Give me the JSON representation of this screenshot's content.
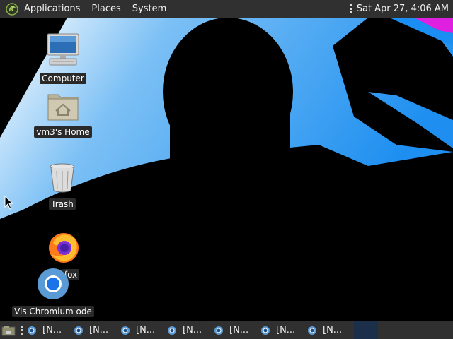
{
  "top_panel": {
    "menus": [
      "Applications",
      "Places",
      "System"
    ],
    "clock": "Sat Apr 27,  4:06 AM"
  },
  "desktop": {
    "icons": [
      {
        "label": "Computer"
      },
      {
        "label": "vm3's Home"
      },
      {
        "label": "Trash"
      },
      {
        "label": "fox"
      },
      {
        "label": "Vis Chromium ode"
      }
    ]
  },
  "taskbar": {
    "tasks": [
      "[N...",
      "[N...",
      "[N...",
      "[N...",
      "[N...",
      "[N...",
      "[N..."
    ]
  },
  "colors": {
    "panel": "#303030",
    "wallpaper_blue": "#2196f3",
    "wallpaper_magenta": "#e020e0"
  }
}
